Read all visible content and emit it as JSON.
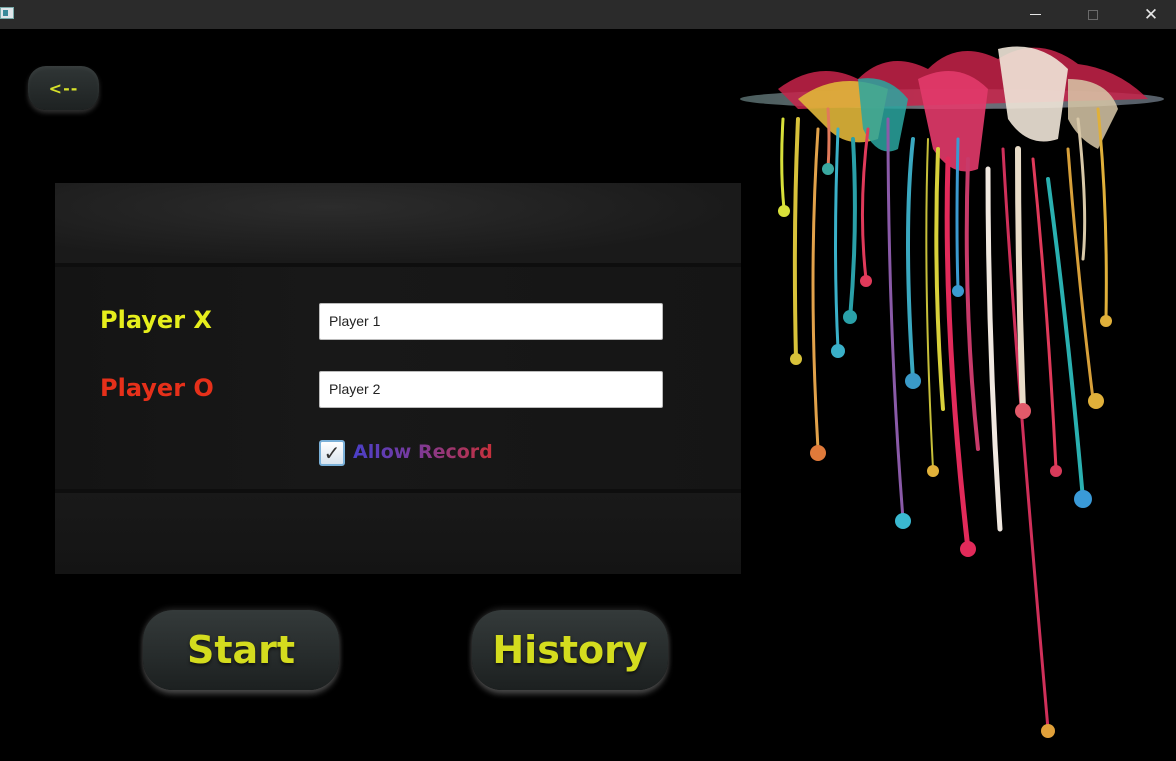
{
  "window": {
    "minimize_icon": "minimize-icon",
    "maximize_icon": "maximize-icon",
    "close_icon": "close-icon",
    "close_glyph": "✕"
  },
  "nav": {
    "back_label": "<--"
  },
  "form": {
    "player_x_label": "Player X",
    "player_o_label": "Player O",
    "player_x_value": "Player 1",
    "player_o_value": "Player 2",
    "allow_record_label": "Allow Record",
    "allow_record_checked": true,
    "check_glyph": "✓"
  },
  "actions": {
    "start_label": "Start",
    "history_label": "History"
  },
  "colors": {
    "accent_yellow": "#d4dc1e",
    "player_x": "#e6ee1c",
    "player_o": "#e6301a",
    "background": "#000000"
  },
  "decoration": {
    "image": "paint-splash-art"
  }
}
